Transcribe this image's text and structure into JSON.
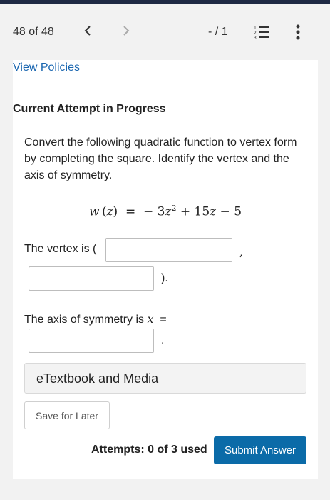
{
  "header": {
    "page_count": "48 of 48",
    "score": "- / 1"
  },
  "card": {
    "view_policies": "View Policies",
    "heading": "Current Attempt in Progress",
    "question": "Convert the following quadratic function to vertex form by completing the square. Identify the vertex and the axis of symmetry.",
    "vertex_label": "The vertex is (",
    "comma": ",",
    "close_paren": ").",
    "axis_label": "The axis of symmetry is",
    "axis_var": "x",
    "axis_equals": "=",
    "period": ".",
    "vertex_x_value": "",
    "vertex_y_value": "",
    "axis_value": "",
    "etextbook": "eTextbook and Media",
    "save_later": "Save for Later",
    "attempts": "Attempts: 0 of 3 used",
    "submit": "Submit Answer"
  },
  "colors": {
    "link": "#1a66b0",
    "submit_bg": "#0b6ba8",
    "top_strip": "#1f2a44"
  }
}
